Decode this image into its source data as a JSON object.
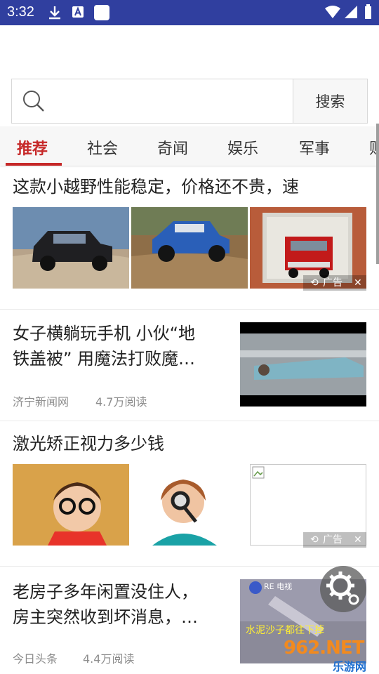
{
  "status_bar": {
    "time": "3:32"
  },
  "search": {
    "placeholder": "",
    "button_label": "搜索"
  },
  "tabs": [
    "推荐",
    "社会",
    "奇闻",
    "娱乐",
    "军事",
    "财"
  ],
  "feed": [
    {
      "title": "这款小越野性能稳定，价格还不贵，速",
      "ad_label": "广告"
    },
    {
      "title_line1": "女子横躺玩手机 小伙“地",
      "title_line2": "铁盖被” 用魔法打败魔…",
      "source": "济宁新闻网",
      "reads": "4.7万阅读"
    },
    {
      "title": "激光矫正视力多少钱",
      "ad_label": "广告"
    },
    {
      "title_line1": "老房子多年闲置没住人，",
      "title_line2": "房主突然收到坏消息，…",
      "source": "今日头条",
      "reads": "4.4万阅读",
      "thumb_caption": "水泥沙子都往下掉",
      "thumb_logo": "RE 电视"
    }
  ],
  "watermark": {
    "number": "962.NET",
    "label": "乐游网"
  }
}
